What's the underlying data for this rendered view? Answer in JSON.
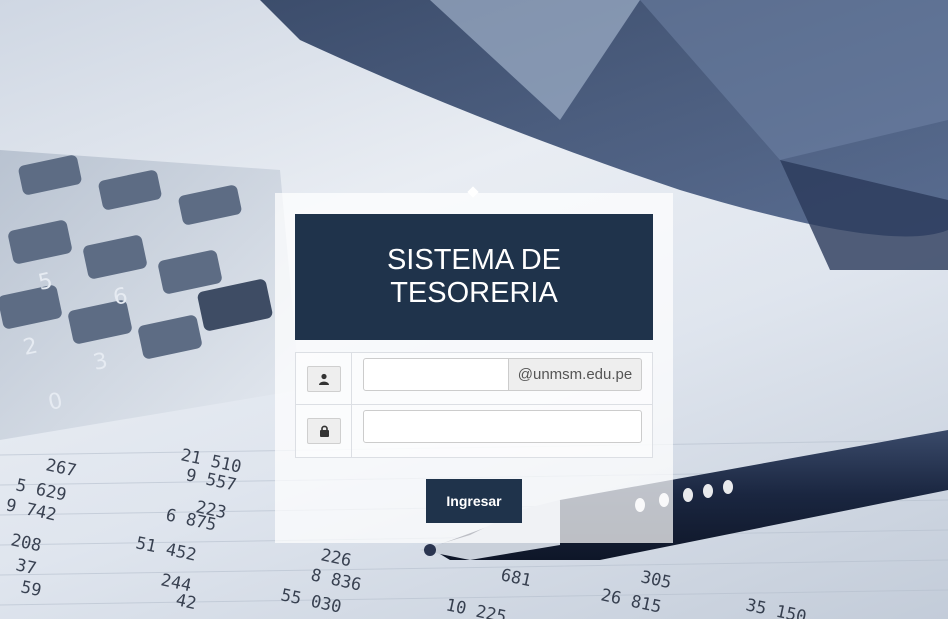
{
  "header": {
    "title": "SISTEMA DE TESORERIA"
  },
  "form": {
    "username": {
      "value": "",
      "placeholder": "",
      "icon": "user-icon",
      "domain_suffix": "@unmsm.edu.pe"
    },
    "password": {
      "value": "",
      "placeholder": "",
      "icon": "lock-icon"
    },
    "submit_label": "Ingresar"
  },
  "colors": {
    "primary": "#1f334b",
    "addon_bg": "#eeeeee",
    "input_border": "#cccccc"
  }
}
